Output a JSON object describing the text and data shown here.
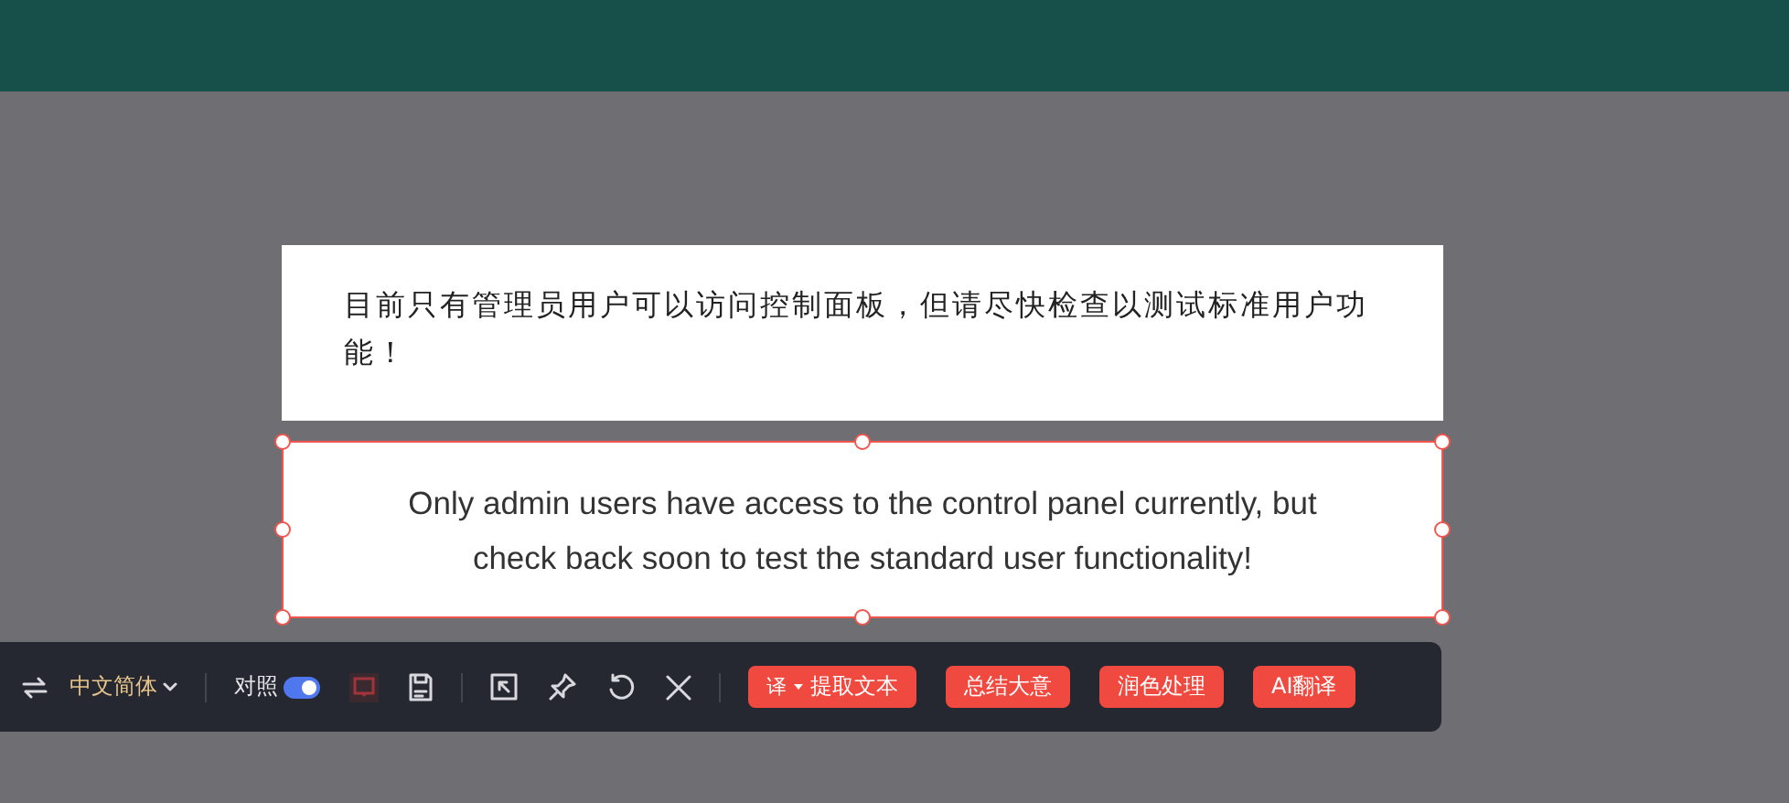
{
  "translation": {
    "text": "目前只有管理员用户可以访问控制面板，但请尽快检查以测试标准用户功能！"
  },
  "source": {
    "text": "Only admin users have access to the control panel currently, but check back soon to test the standard user functionality!",
    "selected": true
  },
  "toolbar": {
    "language": "中文简体",
    "compare_label": "对照",
    "compare_on": true,
    "actions": [
      {
        "kind": "extract",
        "icon_text": "译",
        "label": "提取文本"
      },
      {
        "kind": "plain",
        "label": "总结大意"
      },
      {
        "kind": "plain",
        "label": "润色处理"
      },
      {
        "kind": "plain",
        "label": "AI翻译"
      }
    ]
  }
}
